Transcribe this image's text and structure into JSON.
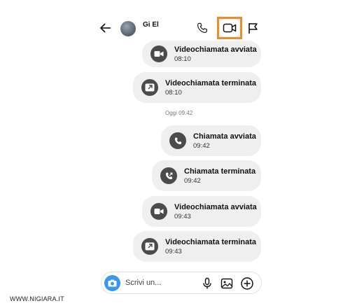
{
  "header": {
    "contact_name": "Gi El"
  },
  "messages": [
    {
      "type": "video-call-started",
      "title": "Videochiamata avviata",
      "time": "08:10"
    },
    {
      "type": "video-call-ended",
      "title": "Videochiamata terminata",
      "time": "08:10"
    },
    {
      "type": "voice-call-started",
      "title": "Chiamata avviata",
      "time": "09:42"
    },
    {
      "type": "voice-call-ended",
      "title": "Chiamata terminata",
      "time": "09:42"
    },
    {
      "type": "video-call-started",
      "title": "Videochiamata avviata",
      "time": "09:43"
    },
    {
      "type": "video-call-ended",
      "title": "Videochiamata terminata",
      "time": "09:43"
    }
  ],
  "day_separator": "Oggi 09:42",
  "composer": {
    "placeholder": "Scrivi un..."
  },
  "watermark": "WWW.NIGIARA.IT",
  "colors": {
    "highlight": "#f08a24",
    "camera_button": "#3897f0",
    "bubble": "#efefef",
    "icon_circle": "#4b4b4b"
  },
  "icons": {
    "back": "arrow-left-icon",
    "phone": "phone-icon",
    "video": "video-camera-icon",
    "flag": "flag-icon",
    "camera": "camera-icon",
    "mic": "microphone-icon",
    "gallery": "image-icon",
    "plus": "plus-circle-icon"
  }
}
